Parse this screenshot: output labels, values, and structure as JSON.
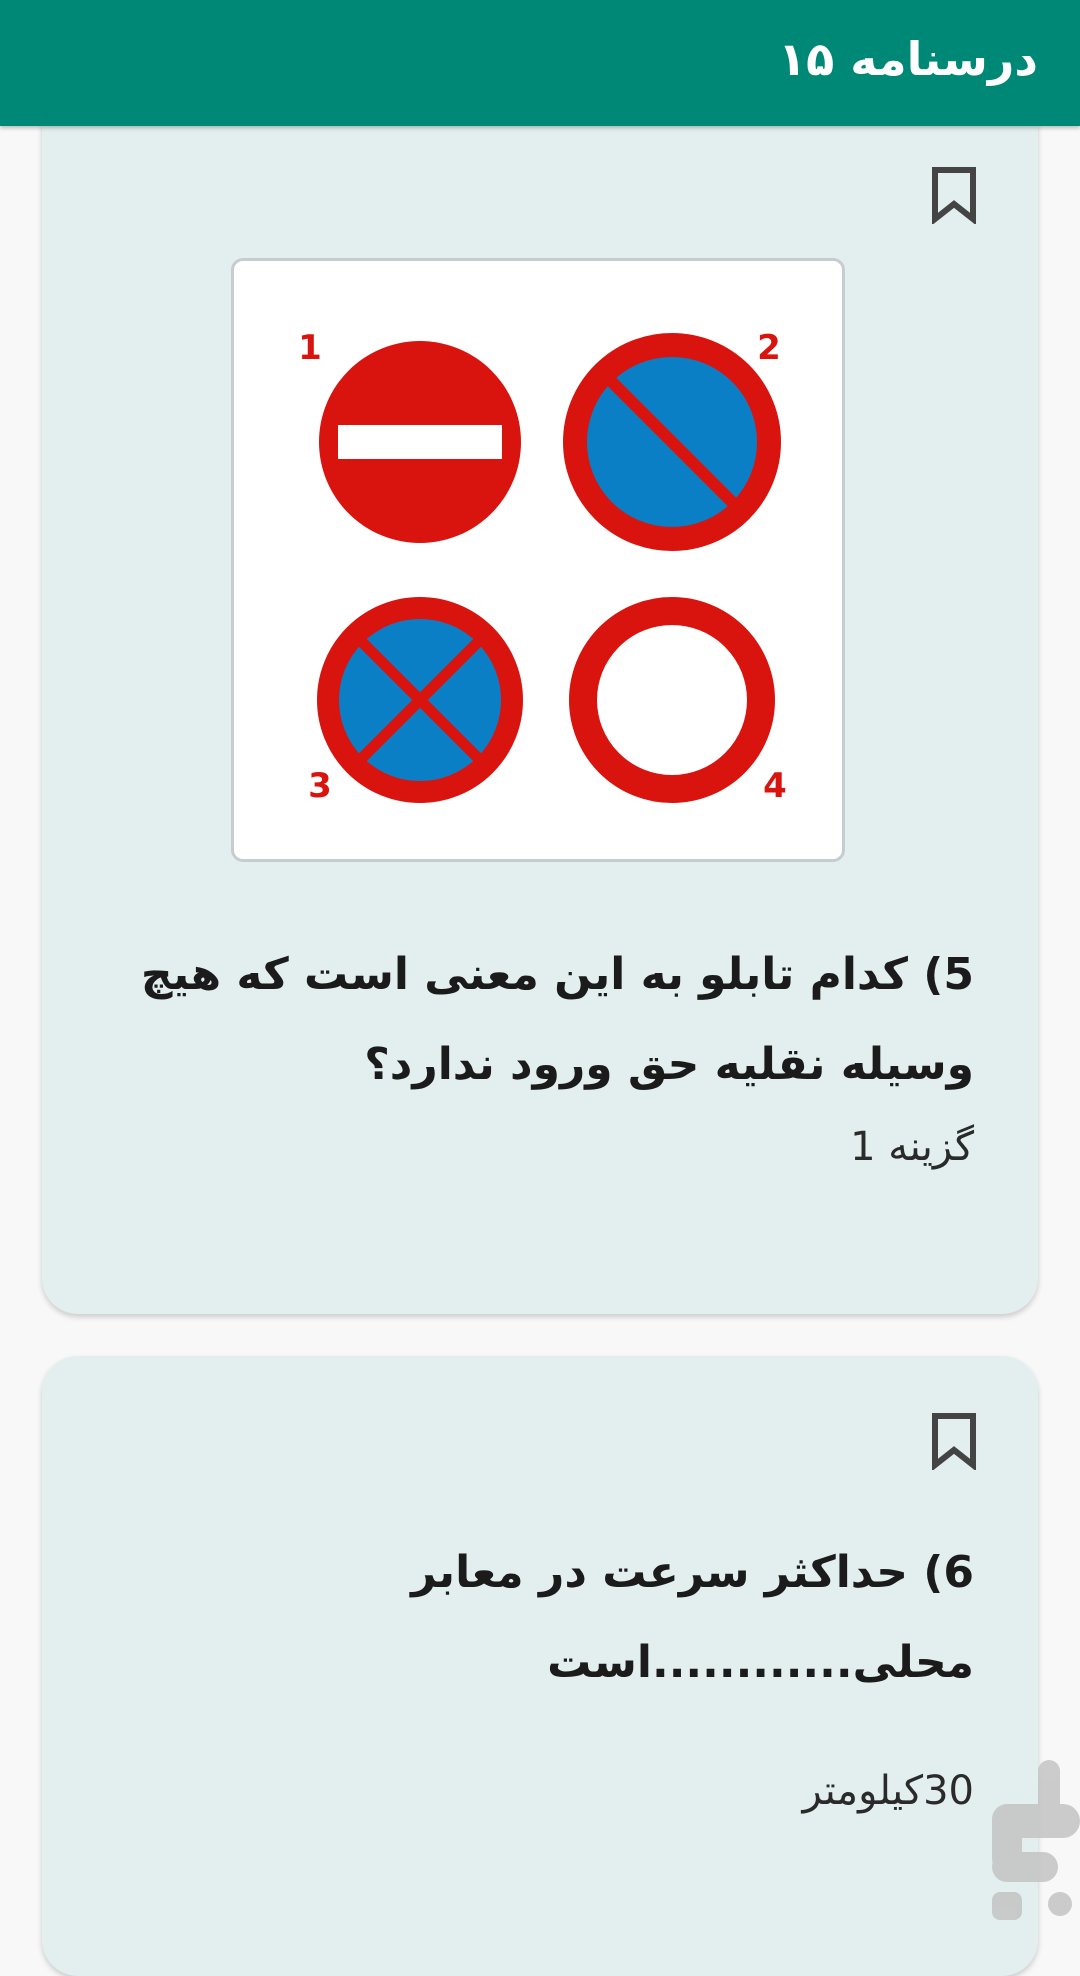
{
  "app_bar": {
    "title": "درسنامه ۱۵"
  },
  "cards": [
    {
      "question": "5) کدام تابلو به این معنی است که هیچ وسیله نقلیه حق ورود ندارد؟",
      "answer": "گزینه 1",
      "image": {
        "labels": [
          "1",
          "2",
          "3",
          "4"
        ],
        "signs": [
          "no-entry-sign",
          "no-parking-sign",
          "no-stopping-sign",
          "no-vehicles-sign"
        ]
      }
    },
    {
      "question": "6) حداکثر سرعت در معابر محلی............است",
      "answer": "30کیلومتر"
    }
  ],
  "colors": {
    "app_bar": "#008876",
    "card_bg": "#e3efef",
    "sign_red": "#d9140f",
    "sign_blue": "#0a7fc6"
  },
  "icons": {
    "bookmark": "bookmark-icon",
    "watermark": "store-logo-icon"
  }
}
